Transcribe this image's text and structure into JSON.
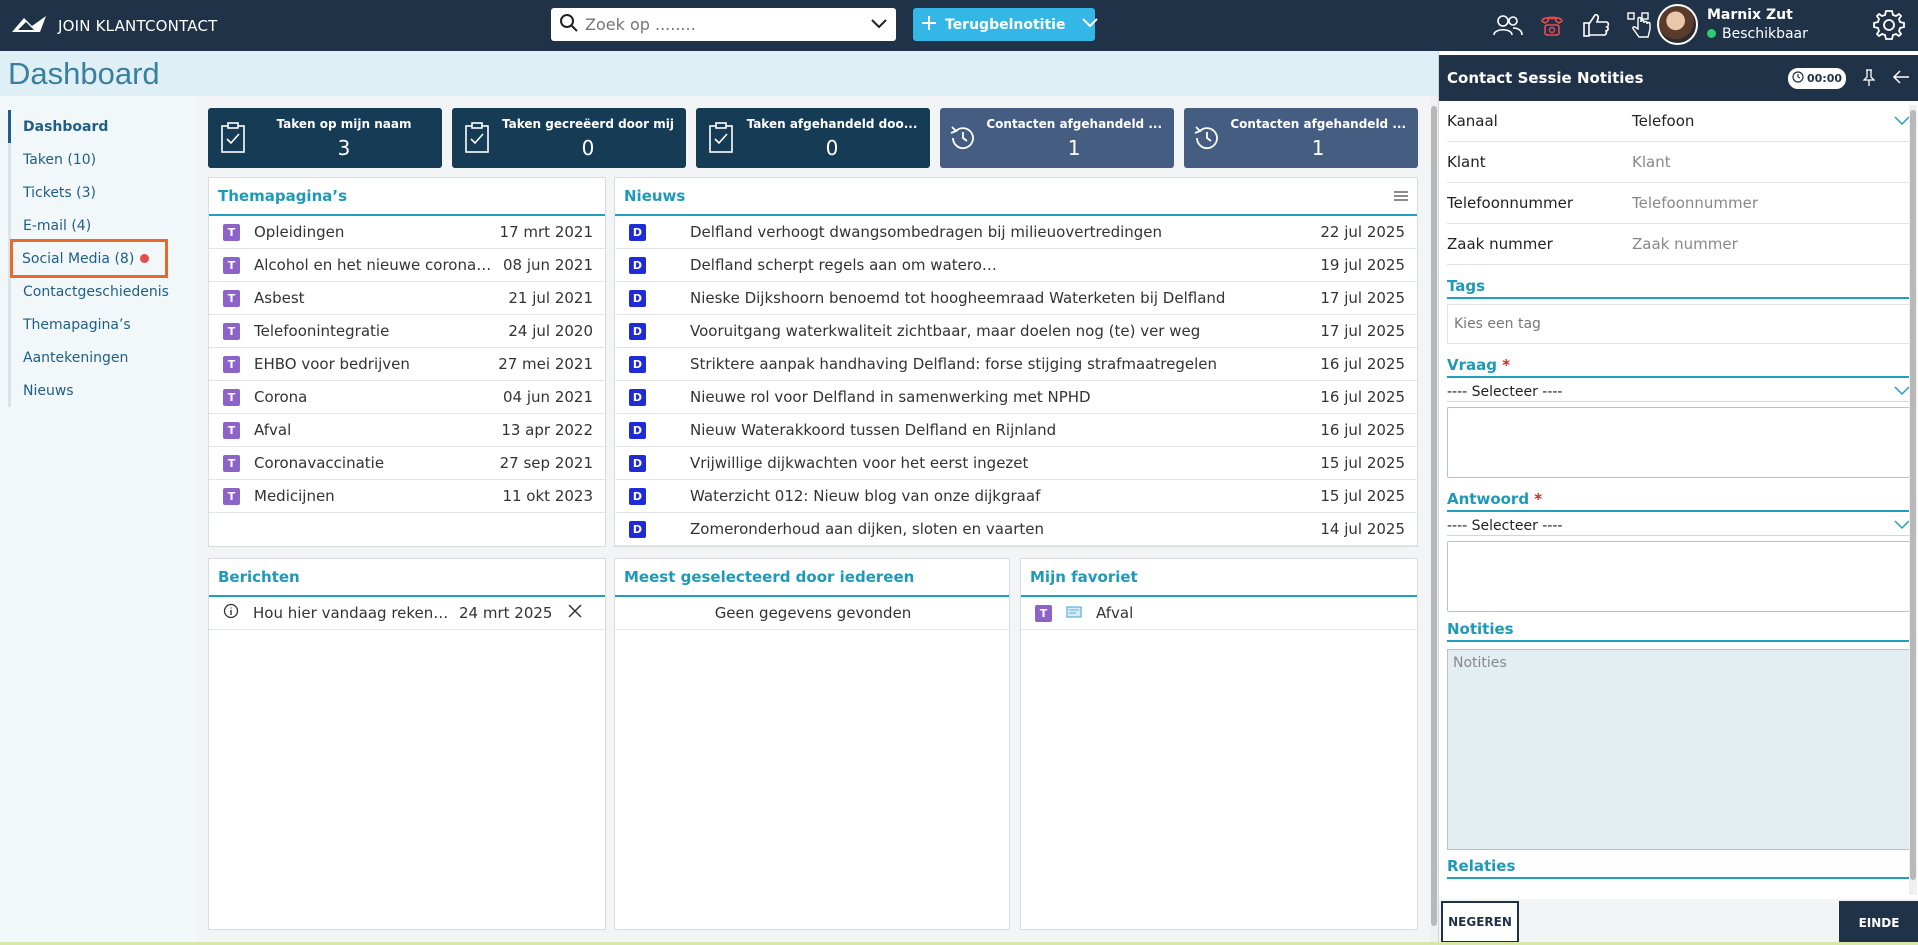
{
  "app": {
    "title": "JOIN KLANTCONTACT"
  },
  "search": {
    "placeholder": "Zoek op ........"
  },
  "header": {
    "note_button": "Terugbelnotitie"
  },
  "user": {
    "name": "Marnix Zut",
    "status": "Beschikbaar"
  },
  "page": {
    "title": "Dashboard"
  },
  "sidebar": {
    "items": [
      {
        "label": "Dashboard"
      },
      {
        "label": "Taken (10)"
      },
      {
        "label": "Tickets (3)"
      },
      {
        "label": "E-mail (4)"
      },
      {
        "label": "Social Media (8)"
      },
      {
        "label": "Contactgeschiedenis"
      },
      {
        "label": "Themapagina’s"
      },
      {
        "label": "Aantekeningen"
      },
      {
        "label": "Nieuws"
      }
    ]
  },
  "tiles": [
    {
      "label": "Taken op mijn naam",
      "value": "3"
    },
    {
      "label": "Taken gecreëerd door mij",
      "value": "0"
    },
    {
      "label": "Taken afgehandeld doo...",
      "value": "0"
    },
    {
      "label": "Contacten afgehandeld ...",
      "value": "1"
    },
    {
      "label": "Contacten afgehandeld ...",
      "value": "1"
    }
  ],
  "themapaginas": {
    "title": "Themapagina’s",
    "badge": "T",
    "rows": [
      {
        "title": "Opleidingen",
        "date": "17 mrt 2021"
      },
      {
        "title": "Alcohol en het nieuwe coronavirus",
        "date": "08 jun 2021"
      },
      {
        "title": "Asbest",
        "date": "21 jul 2021"
      },
      {
        "title": "Telefoonintegratie",
        "date": "24 jul 2020"
      },
      {
        "title": "EHBO voor bedrijven",
        "date": "27 mei 2021"
      },
      {
        "title": "Corona",
        "date": "04 jun 2021"
      },
      {
        "title": "Afval",
        "date": "13 apr 2022"
      },
      {
        "title": "Coronavaccinatie",
        "date": "27 sep 2021"
      },
      {
        "title": "Medicijnen",
        "date": "11 okt 2023"
      }
    ]
  },
  "nieuws": {
    "title": "Nieuws",
    "badge": "D",
    "rows": [
      {
        "title": "Delfland verhoogt dwangsombedragen bij milieuovertredingen",
        "date": "22 jul 2025"
      },
      {
        "title": "Delfland scherpt regels aan om wateroverlast bij ruimtelijke ontwikkelingen",
        "date": "19 jul 2025"
      },
      {
        "title": "Nieske Dijkshoorn benoemd tot hoogheemraad Waterketen bij Delfland",
        "date": "17 jul 2025"
      },
      {
        "title": "Vooruitgang waterkwaliteit zichtbaar, maar doelen nog (te) ver weg",
        "date": "17 jul 2025"
      },
      {
        "title": "Striktere aanpak handhaving Delfland: forse stijging strafmaatregelen",
        "date": "16 jul 2025"
      },
      {
        "title": "Nieuwe rol voor Delfland in samenwerking met NPHD",
        "date": "16 jul 2025"
      },
      {
        "title": "Nieuw Waterakkoord tussen Delfland en Rijnland",
        "date": "16 jul 2025"
      },
      {
        "title": "Vrijwillige dijkwachten voor het eerst ingezet",
        "date": "15 jul 2025"
      },
      {
        "title": "Waterzicht 012: Nieuw blog van onze dijkgraaf",
        "date": "15 jul 2025"
      },
      {
        "title": "Zomeronderhoud aan dijken, sloten en vaarten",
        "date": "14 jul 2025"
      }
    ]
  },
  "berichten": {
    "title": "Berichten",
    "rows": [
      {
        "title": "Hou hier vandaag rekening mee",
        "date": "24 mrt 2025"
      }
    ]
  },
  "meest": {
    "title": "Meest geselecteerd door iedereen",
    "empty": "Geen gegevens gevonden"
  },
  "favoriet": {
    "title": "Mijn favoriet",
    "badge": "T",
    "rows": [
      {
        "title": "Afval"
      }
    ]
  },
  "session": {
    "title": "Contact Sessie Notities",
    "timer": "00:00",
    "fields": [
      {
        "label": "Kanaal",
        "value": "Telefoon"
      },
      {
        "label": "Klant",
        "placeholder": "Klant"
      },
      {
        "label": "Telefoonnummer",
        "placeholder": "Telefoonnummer"
      },
      {
        "label": "Zaak nummer",
        "placeholder": "Zaak nummer"
      }
    ],
    "tags_title": "Tags",
    "tags_placeholder": "Kies een tag",
    "vraag_title": "Vraag",
    "antwoord_title": "Antwoord",
    "required_mark": "*",
    "select_placeholder": "---- Selecteer ----",
    "notities_title": "Notities",
    "notities_placeholder": "Notities",
    "relaties_title": "Relaties",
    "ignore_button": "NEGEREN",
    "end_button": "EINDE"
  }
}
